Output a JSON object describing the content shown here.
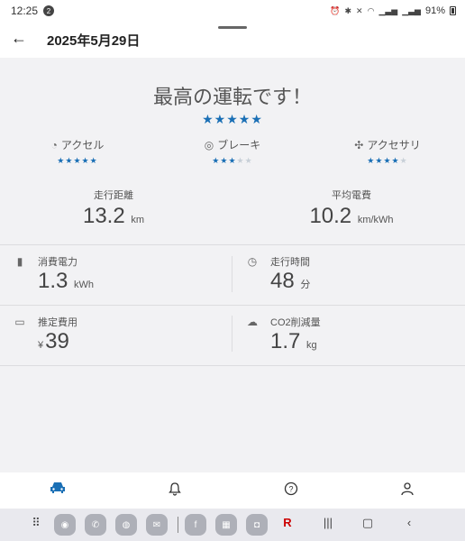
{
  "status_bar": {
    "time": "12:25",
    "notification_count": "2",
    "battery_percent": "91%",
    "icons": [
      "alarm-icon",
      "bluetooth-icon",
      "mute-icon",
      "wifi-icon",
      "signal-icon",
      "signal-icon"
    ]
  },
  "header": {
    "title": "2025年5月29日",
    "back_icon": "arrow-left-icon"
  },
  "summary": {
    "headline": "最高の運転です！",
    "overall_stars": 5,
    "stars_max": 5
  },
  "categories": [
    {
      "label": "アクセル",
      "icon": "accelerator-gauge-icon",
      "stars": 5
    },
    {
      "label": "ブレーキ",
      "icon": "brake-icon",
      "stars": 3
    },
    {
      "label": "アクセサリ",
      "icon": "fan-icon",
      "stars": 4
    }
  ],
  "metrics": {
    "distance": {
      "label": "走行距離",
      "value": "13.2",
      "unit": "km"
    },
    "efficiency": {
      "label": "平均電費",
      "value": "10.2",
      "unit": "km/kWh"
    }
  },
  "details": {
    "power": {
      "label": "消費電力",
      "value": "1.3",
      "unit": "kWh",
      "icon": "battery-icon"
    },
    "time": {
      "label": "走行時間",
      "value": "48",
      "unit": "分",
      "icon": "clock-icon"
    },
    "cost": {
      "label": "推定費用",
      "prefix": "¥",
      "value": "39",
      "icon": "card-icon"
    },
    "co2": {
      "label": "CO2削減量",
      "value": "1.7",
      "unit": "kg",
      "icon": "co2-cloud-icon"
    }
  },
  "bottom_nav": [
    "car-icon",
    "bell-icon",
    "help-icon",
    "person-icon"
  ],
  "accent_color": "#1a6fb5"
}
